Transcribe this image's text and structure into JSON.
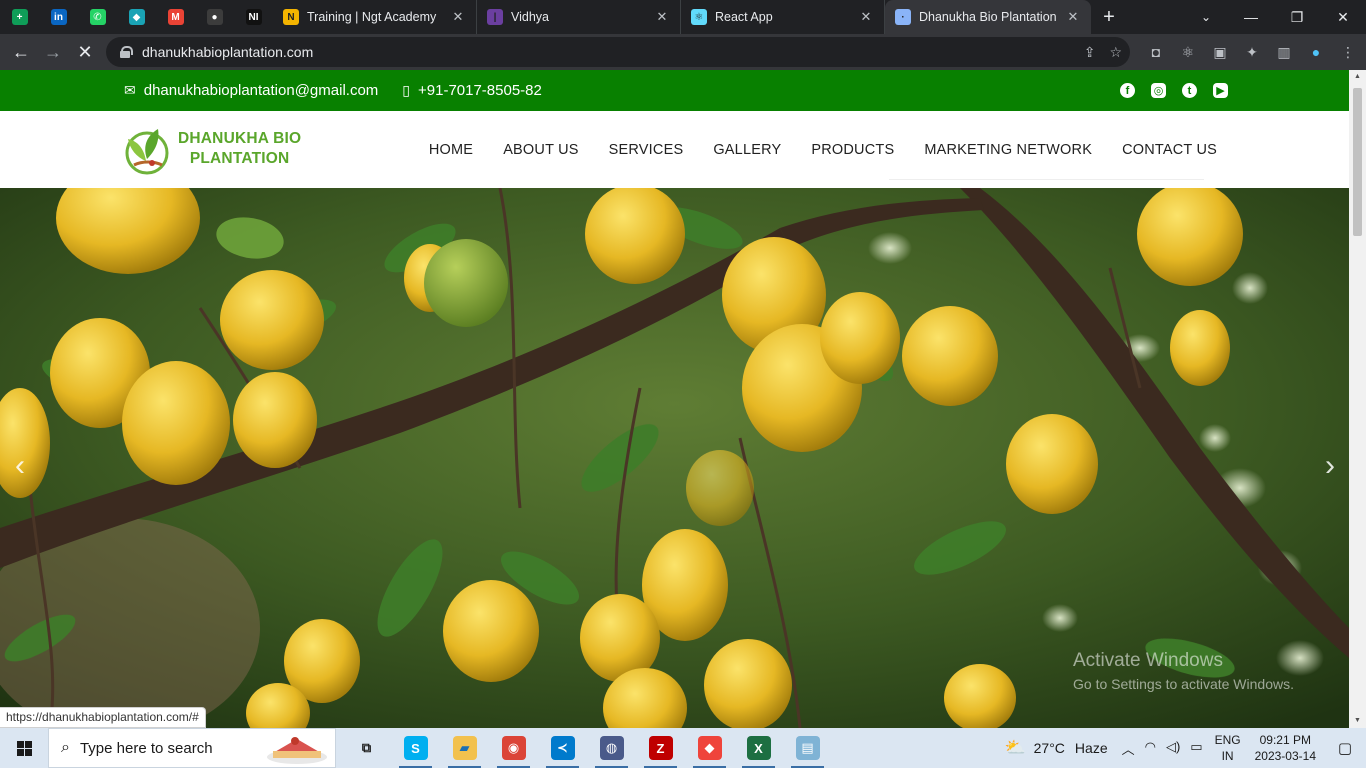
{
  "browser": {
    "pinned_tabs": [
      {
        "icon": "google-sheets-icon",
        "glyph": "+",
        "color": "#0f9d58"
      },
      {
        "icon": "linkedin-icon",
        "glyph": "in",
        "color": "#0a66c2"
      },
      {
        "icon": "whatsapp-icon",
        "glyph": "✆",
        "color": "#25d366"
      },
      {
        "icon": "diamond-app-icon",
        "glyph": "◆",
        "color": "#1aa3b5"
      },
      {
        "icon": "gmail-icon",
        "glyph": "M",
        "color": "#ea4335"
      },
      {
        "icon": "github-icon",
        "glyph": "●",
        "color": "#3c3c3c"
      },
      {
        "icon": "notion-icon",
        "glyph": "NI",
        "color": "#111111"
      }
    ],
    "tabs": [
      {
        "title": "Training | Ngt Academy",
        "icon": "ngt-academy-icon",
        "glyph": "N",
        "color": "#f4b400"
      },
      {
        "title": "Vidhya",
        "icon": "vidhya-icon",
        "glyph": "|",
        "color": "#6b3fa0"
      },
      {
        "title": "React App",
        "icon": "react-icon",
        "glyph": "⚛",
        "color": "#61dafb"
      },
      {
        "title": "Dhanukha Bio Plantation",
        "icon": "loading-icon",
        "glyph": "·",
        "color": "#8ab4f8"
      }
    ],
    "close_glyph": "✕",
    "new_tab_glyph": "+",
    "url": "dhanukhabioplantation.com"
  },
  "site": {
    "email": "dhanukhabioplantation@gmail.com",
    "phone": "+91-7017-8505-82",
    "brand_line1": "DHANUKHA BIO",
    "brand_line2": "PLANTATION",
    "nav": [
      {
        "label": "HOME"
      },
      {
        "label": "ABOUT US"
      },
      {
        "label": "SERVICES"
      },
      {
        "label": "GALLERY"
      },
      {
        "label": "PRODUCTS"
      },
      {
        "label": "MARKETING NETWORK"
      },
      {
        "label": "CONTACT US"
      }
    ],
    "colors": {
      "topbar": "#088000",
      "brand": "#5aa62b"
    }
  },
  "overlay": {
    "activate_title": "Activate Windows",
    "activate_sub": "Go to Settings to activate Windows.",
    "status_url": "https://dhanukhabioplantation.com/#"
  },
  "taskbar": {
    "search_placeholder": "Type here to search",
    "apps": [
      {
        "name": "task-view",
        "glyph": "⧉",
        "color": "#dbe6f2",
        "fg": "#1a1a1a",
        "running": false
      },
      {
        "name": "skype",
        "glyph": "S",
        "color": "#00aff0",
        "fg": "#ffffff",
        "running": true
      },
      {
        "name": "file-explorer",
        "glyph": "▰",
        "color": "#f2c14e",
        "fg": "#1a6fb5",
        "running": true
      },
      {
        "name": "chrome",
        "glyph": "◉",
        "color": "#db4437",
        "fg": "#ffffff",
        "running": true
      },
      {
        "name": "vscode",
        "glyph": "≺",
        "color": "#007acc",
        "fg": "#ffffff",
        "running": true
      },
      {
        "name": "media-player",
        "glyph": "◍",
        "color": "#4a5a8a",
        "fg": "#ffffff",
        "running": true
      },
      {
        "name": "filezilla",
        "glyph": "Z",
        "color": "#bf0000",
        "fg": "#ffffff",
        "running": true
      },
      {
        "name": "anydesk",
        "glyph": "◆",
        "color": "#ef443b",
        "fg": "#ffffff",
        "running": true
      },
      {
        "name": "excel",
        "glyph": "X",
        "color": "#1d6f42",
        "fg": "#ffffff",
        "running": true
      },
      {
        "name": "notepad",
        "glyph": "▤",
        "color": "#7fb3d5",
        "fg": "#ffffff",
        "running": true
      }
    ],
    "weather_temp": "27°C",
    "weather_desc": "Haze",
    "lang_1": "ENG",
    "lang_2": "IN",
    "time": "09:21 PM",
    "date": "2023-03-14"
  }
}
